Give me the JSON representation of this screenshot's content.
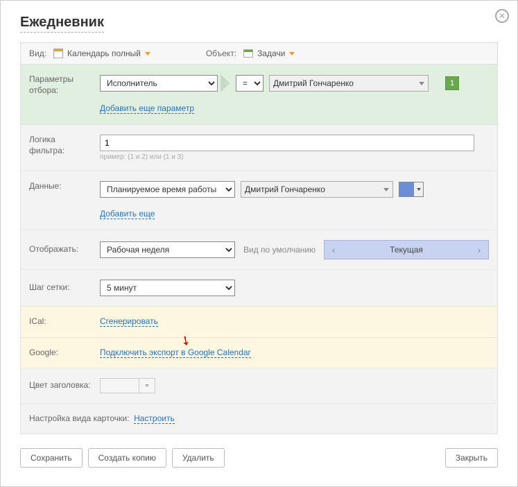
{
  "title": "Ежедневник",
  "toolbar": {
    "view_label": "Вид:",
    "view_value": "Календарь полный",
    "object_label": "Объект:",
    "object_value": "Задачи"
  },
  "filter": {
    "label": "Параметры отбора:",
    "field": "Исполнитель",
    "operator": "=",
    "value": "Дмитрий Гончаренко",
    "badge": "1",
    "add_link": "Добавить еще параметр"
  },
  "logic": {
    "label": "Логика фильтра:",
    "value": "1",
    "hint": "пример: (1 и 2) или (1 и 3)"
  },
  "data": {
    "label": "Данные:",
    "field": "Планируемое время работы",
    "value": "Дмитрий Гончаренко",
    "add_link": "Добавить еще"
  },
  "display": {
    "label": "Отображать:",
    "value": "Рабочая неделя",
    "default_label": "Вид по умолчанию",
    "nav_value": "Текущая"
  },
  "grid": {
    "label": "Шаг сетки:",
    "value": "5 минут"
  },
  "ical": {
    "label": "ICal:",
    "link": "Сгенерировать"
  },
  "google": {
    "label": "Google:",
    "link": "Подключить экспорт в Google Calendar"
  },
  "headercolor": {
    "label": "Цвет заголовка:"
  },
  "card": {
    "label": "Настройка вида карточки:",
    "link": "Настроить"
  },
  "buttons": {
    "save": "Сохранить",
    "copy": "Создать копию",
    "delete": "Удалить",
    "close": "Закрыть"
  }
}
